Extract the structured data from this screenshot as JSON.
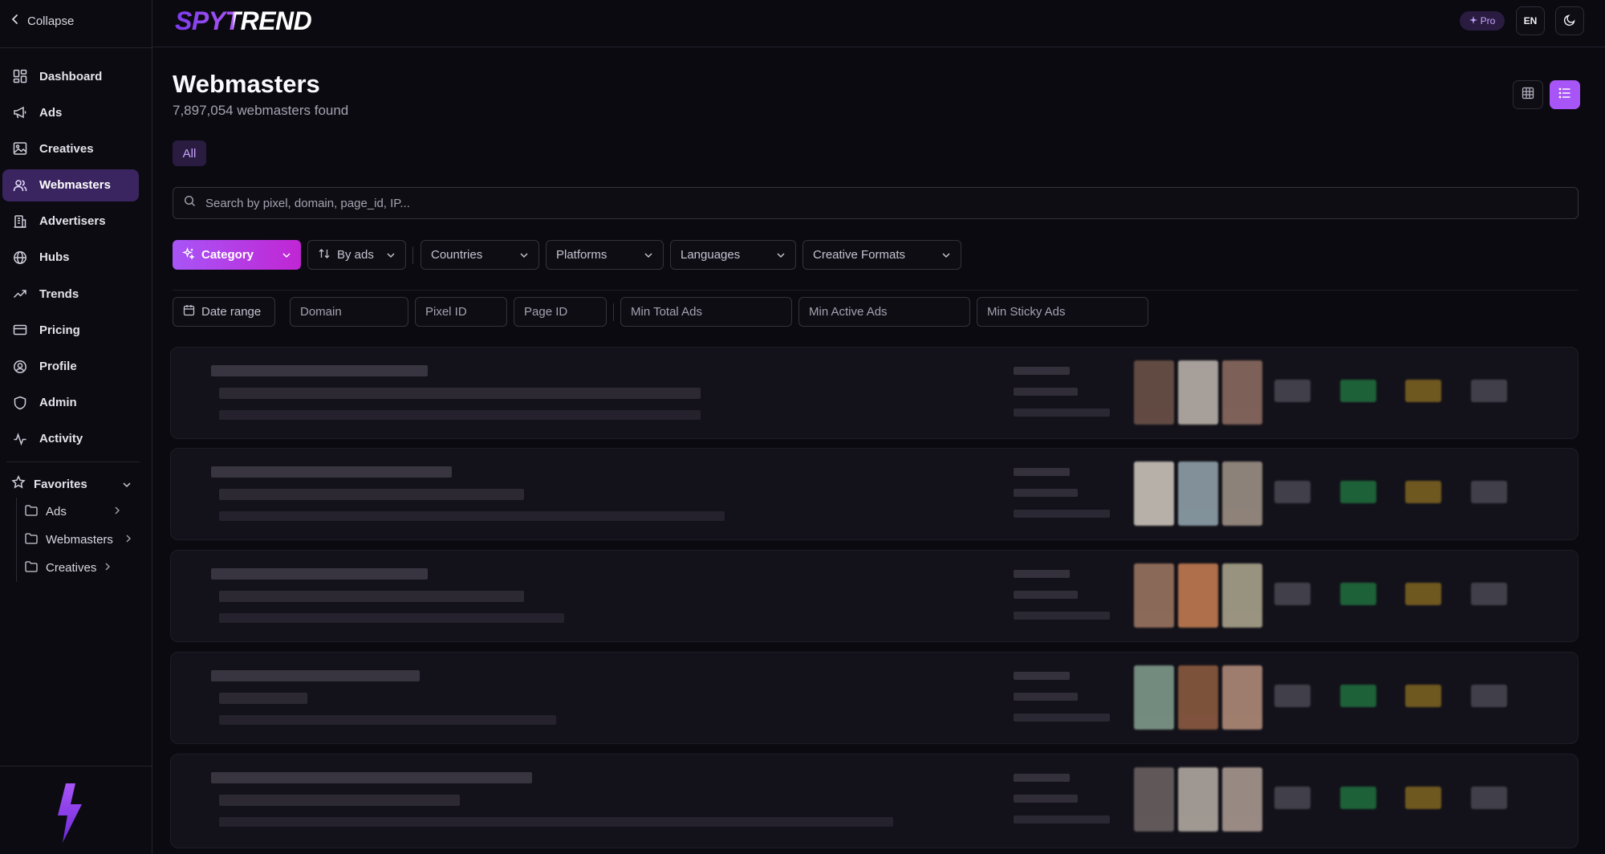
{
  "brand": {
    "name": "SPYTREND",
    "primary": "#7c3aed",
    "accent": "#a855f7"
  },
  "sidebar": {
    "collapse_label": "Collapse",
    "items": [
      {
        "label": "Dashboard",
        "icon": "dashboard-icon",
        "active": false
      },
      {
        "label": "Ads",
        "icon": "megaphone-icon",
        "active": false
      },
      {
        "label": "Creatives",
        "icon": "image-icon",
        "active": false
      },
      {
        "label": "Webmasters",
        "icon": "users-icon",
        "active": true
      },
      {
        "label": "Advertisers",
        "icon": "building-icon",
        "active": false
      },
      {
        "label": "Hubs",
        "icon": "globe-icon",
        "active": false
      },
      {
        "label": "Trends",
        "icon": "trending-up-icon",
        "active": false
      },
      {
        "label": "Pricing",
        "icon": "credit-card-icon",
        "active": false
      },
      {
        "label": "Profile",
        "icon": "user-circle-icon",
        "active": false
      },
      {
        "label": "Admin",
        "icon": "shield-icon",
        "active": false
      },
      {
        "label": "Activity",
        "icon": "activity-icon",
        "active": false
      }
    ],
    "favorites": {
      "label": "Favorites",
      "items": [
        {
          "label": "Ads"
        },
        {
          "label": "Webmasters"
        },
        {
          "label": "Creatives"
        }
      ]
    }
  },
  "topbar": {
    "pro_label": "Pro",
    "language": "EN"
  },
  "main": {
    "title": "Webmasters",
    "subtitle": "7,897,054 webmasters found",
    "tab_all": "All",
    "search_placeholder": "Search by pixel, domain, page_id, IP...",
    "filters": {
      "category": "Category",
      "sort": "By ads",
      "countries": "Countries",
      "platforms": "Platforms",
      "languages": "Languages",
      "creative_formats": "Creative Formats"
    },
    "inputs": {
      "date_range": "Date range",
      "domain": "Domain",
      "pixel_id": "Pixel ID",
      "page_id": "Page ID",
      "min_total_ads": "Min Total Ads",
      "min_active_ads": "Min Active Ads",
      "min_sticky_ads": "Min Sticky Ads"
    }
  }
}
